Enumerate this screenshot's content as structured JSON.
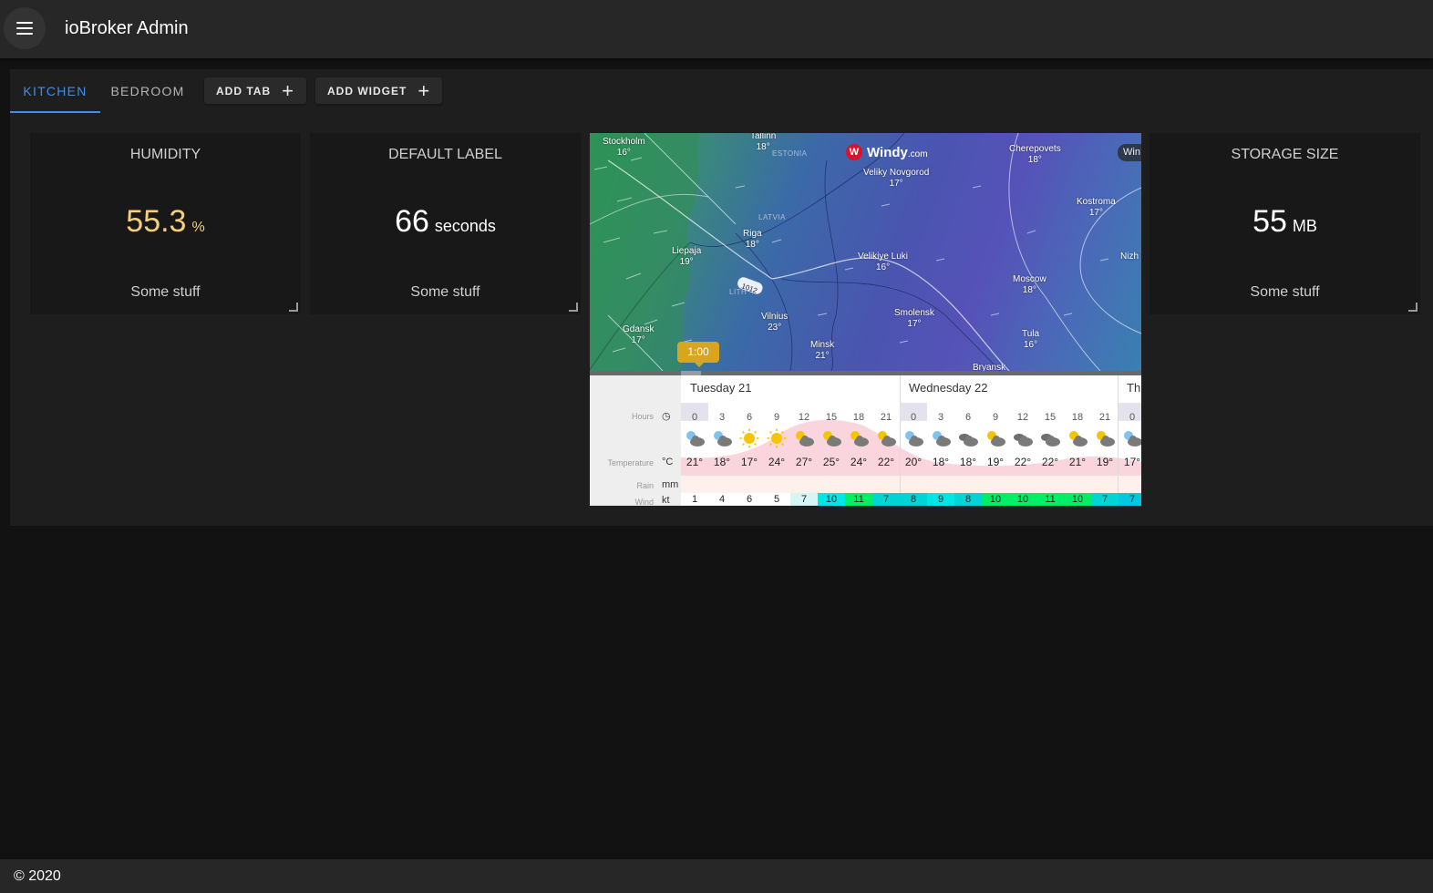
{
  "app": {
    "title": "ioBroker Admin"
  },
  "tabs": [
    {
      "label": "KITCHEN",
      "active": true
    },
    {
      "label": "BEDROOM",
      "active": false
    }
  ],
  "toolbar": {
    "add_tab": "ADD TAB",
    "add_widget": "ADD WIDGET"
  },
  "widgets": [
    {
      "title": "HUMIDITY",
      "value": "55.3",
      "unit": "%",
      "footer": "Some stuff"
    },
    {
      "title": "DEFAULT LABEL",
      "value": "66",
      "unit": "seconds",
      "footer": "Some stuff"
    },
    {
      "title": "STORAGE SIZE",
      "value": "55",
      "unit": "MB",
      "footer": "Some stuff"
    }
  ],
  "windy": {
    "logo": "Windy",
    "logo_suffix": ".com",
    "pill": "Win",
    "time": "1:00",
    "isobar": "1012",
    "countries": [
      "ESTONIA",
      "LATVIA",
      "LITH"
    ],
    "cities": [
      {
        "name": "Stockholm",
        "temp": "16°"
      },
      {
        "name": "Tallinn",
        "temp": "18°"
      },
      {
        "name": "Veliky Novgorod",
        "temp": "17°"
      },
      {
        "name": "Cherepovets",
        "temp": "18°"
      },
      {
        "name": "Kostroma",
        "temp": "17°"
      },
      {
        "name": "Liepaja",
        "temp": "19°"
      },
      {
        "name": "Riga",
        "temp": "18°"
      },
      {
        "name": "Velikiye Luki",
        "temp": "16°"
      },
      {
        "name": "Moscow",
        "temp": "18°"
      },
      {
        "name": "Nizh",
        "temp": ""
      },
      {
        "name": "Gdansk",
        "temp": "17°"
      },
      {
        "name": "Vilnius",
        "temp": "23°"
      },
      {
        "name": "Smolensk",
        "temp": "17°"
      },
      {
        "name": "Minsk",
        "temp": "21°"
      },
      {
        "name": "Tula",
        "temp": "16°"
      },
      {
        "name": "Bryansk",
        "temp": ""
      }
    ],
    "days": [
      "Tuesday 21",
      "Wednesday 22",
      "Th"
    ],
    "row_labels": {
      "hours": "Hours",
      "temperature": "Temperature",
      "rain": "Rain",
      "wind": "Wind"
    },
    "row_units": {
      "temperature": "°C",
      "rain": "mm",
      "wind": "kt"
    },
    "hours": [
      "0",
      "3",
      "6",
      "9",
      "12",
      "15",
      "18",
      "21",
      "0",
      "3",
      "6",
      "9",
      "12",
      "15",
      "18",
      "21",
      "0"
    ],
    "temps": [
      "21°",
      "18°",
      "17°",
      "24°",
      "27°",
      "25°",
      "24°",
      "22°",
      "20°",
      "18°",
      "18°",
      "19°",
      "22°",
      "22°",
      "21°",
      "19°",
      "17°"
    ],
    "wind": [
      "1",
      "4",
      "6",
      "5",
      "7",
      "10",
      "11",
      "7",
      "8",
      "9",
      "8",
      "10",
      "10",
      "11",
      "10",
      "7",
      "7"
    ],
    "icons": [
      "night-cloud",
      "night-cloud",
      "sun",
      "sun",
      "sun-cloud",
      "sun-cloud",
      "sun-cloud",
      "sun-cloud",
      "night-cloud",
      "night-cloud",
      "cloud",
      "sun-cloud",
      "cloud",
      "cloud",
      "sun-cloud",
      "sun-cloud",
      "night-cloud"
    ],
    "wind_colors": [
      "#ffffff",
      "#ffffff",
      "#ffffff",
      "#ffffff",
      "#d6f5f5",
      "#00e5e5",
      "#00ee66",
      "#00d4d4",
      "#00d4d4",
      "#00e5e5",
      "#00d4d4",
      "#00ee66",
      "#00ee66",
      "#00ee66",
      "#00ee66",
      "#00d4d4",
      "#00c8e0"
    ]
  },
  "footer": {
    "text": "© 2020"
  }
}
